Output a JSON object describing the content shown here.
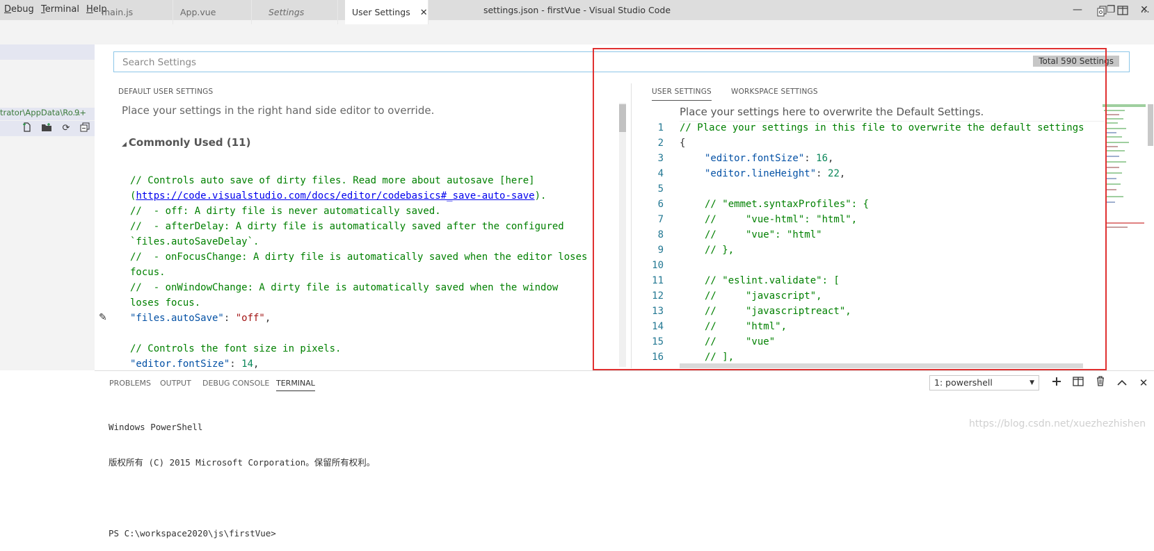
{
  "window": {
    "title": "settings.json - firstVue - Visual Studio Code",
    "menu": [
      {
        "label": "Debug",
        "underline": "D",
        "rest": "ebug"
      },
      {
        "label": "Terminal",
        "underline": "T",
        "rest": "erminal"
      },
      {
        "label": "Help",
        "underline": "H",
        "rest": "elp"
      }
    ],
    "controls": {
      "minimize": "—",
      "restore": "❐",
      "close": "✕"
    }
  },
  "sidebar": {
    "path_text": "trator\\AppData\\Ro...",
    "badge": "9+"
  },
  "tabs": [
    {
      "label": "main.js"
    },
    {
      "label": "App.vue"
    },
    {
      "label": "Settings"
    },
    {
      "label": "User Settings",
      "close": "✕"
    }
  ],
  "search": {
    "placeholder": "Search Settings",
    "total": "Total 590 Settings"
  },
  "default_pane": {
    "label": "DEFAULT USER SETTINGS",
    "hint": "Place your settings in the right hand side editor to override.",
    "section": "Commonly Used (11)",
    "lines": [
      "// Controls auto save of dirty files. Read more about autosave [here]",
      "(",
      "https://code.visualstudio.com/docs/editor/codebasics#_save-auto-save",
      ").",
      "//  - off: A dirty file is never automatically saved.",
      "//  - afterDelay: A dirty file is automatically saved after the configured",
      "`files.autoSaveDelay`.",
      "//  - onFocusChange: A dirty file is automatically saved when the editor loses",
      "focus.",
      "//  - onWindowChange: A dirty file is automatically saved when the window",
      "loses focus.",
      "\"files.autoSave\"",
      ": ",
      "\"off\"",
      ",",
      "// Controls the font size in pixels.",
      "\"editor.fontSize\"",
      ": ",
      "14",
      ","
    ]
  },
  "user_pane": {
    "tab_user": "USER SETTINGS",
    "tab_workspace": "WORKSPACE SETTINGS",
    "hint": "Place your settings here to overwrite the Default Settings.",
    "line_numbers": [
      "1",
      "2",
      "3",
      "4",
      "5",
      "6",
      "7",
      "8",
      "9",
      "10",
      "11",
      "12",
      "13",
      "14",
      "15",
      "16"
    ],
    "code": {
      "l1": "// Place your settings in this file to overwrite the default settings",
      "l2": "{",
      "l3_key": "\"editor.fontSize\"",
      "l3_sep": ": ",
      "l3_val": "16",
      "l3_end": ",",
      "l4_key": "\"editor.lineHeight\"",
      "l4_sep": ": ",
      "l4_val": "22",
      "l4_end": ",",
      "l6": "// \"emmet.syntaxProfiles\": {",
      "l7": "//     \"vue-html\": \"html\",",
      "l8": "//     \"vue\": \"html\"",
      "l9": "// },",
      "l11": "// \"eslint.validate\": [",
      "l12": "//     \"javascript\",",
      "l13": "//     \"javascriptreact\",",
      "l14": "//     \"html\",",
      "l15": "//     \"vue\"",
      "l16": "// ],"
    }
  },
  "panel": {
    "tabs": [
      "PROBLEMS",
      "OUTPUT",
      "DEBUG CONSOLE",
      "TERMINAL"
    ],
    "terminal_select": "1: powershell",
    "output": [
      "Windows PowerShell",
      "版权所有 (C) 2015 Microsoft Corporation。保留所有权利。",
      "",
      "PS C:\\workspace2020\\js\\firstVue>"
    ]
  },
  "watermark": "https://blog.csdn.net/xuezhezhishen",
  "colors": {
    "accent_border": "#e03030",
    "comment": "#008000",
    "key": "#0451a5",
    "string": "#a31515",
    "number": "#098658"
  }
}
